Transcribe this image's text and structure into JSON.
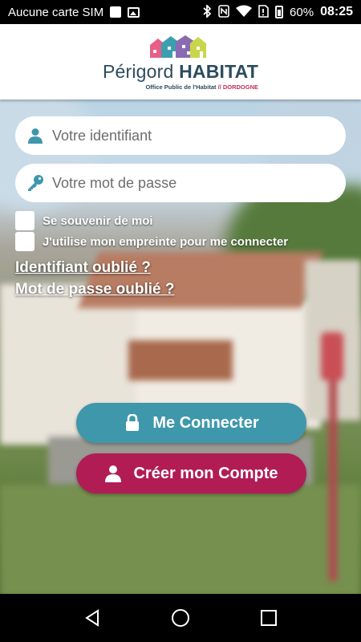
{
  "status_bar": {
    "carrier": "Aucune carte SIM",
    "battery": "60%",
    "time": "08:25",
    "icons": [
      "notification-icon",
      "image-icon",
      "bluetooth-icon",
      "nfc-icon",
      "wifi-icon",
      "no-sim-icon",
      "battery-icon"
    ]
  },
  "header": {
    "brand_light": "Périgord ",
    "brand_bold": "HABITAT",
    "subtitle": "Office Public de l'Habitat",
    "subtitle_accent": " // DORDOGNE",
    "logo_colors": [
      "#3c9fb0",
      "#e85e88",
      "#8a6bb1",
      "#c9d64a"
    ]
  },
  "form": {
    "username_placeholder": "Votre identifiant",
    "password_placeholder": "Votre mot de passe",
    "remember_label": "Se souvenir de moi",
    "fingerprint_label": "J'utilise mon empreinte pour me connecter",
    "remember_checked": false,
    "fingerprint_checked": false
  },
  "links": {
    "forgot_id": "Identifiant oublié ?",
    "forgot_password": "Mot de passe oublié ?"
  },
  "buttons": {
    "connect_label": "Me Connecter",
    "create_label": "Créer mon Compte",
    "connect_color": "#3f97ab",
    "create_color": "#b11c55"
  },
  "colors": {
    "accent_teal": "#3f97ab",
    "accent_magenta": "#b11c55",
    "brand_text": "#2c4c5f"
  }
}
